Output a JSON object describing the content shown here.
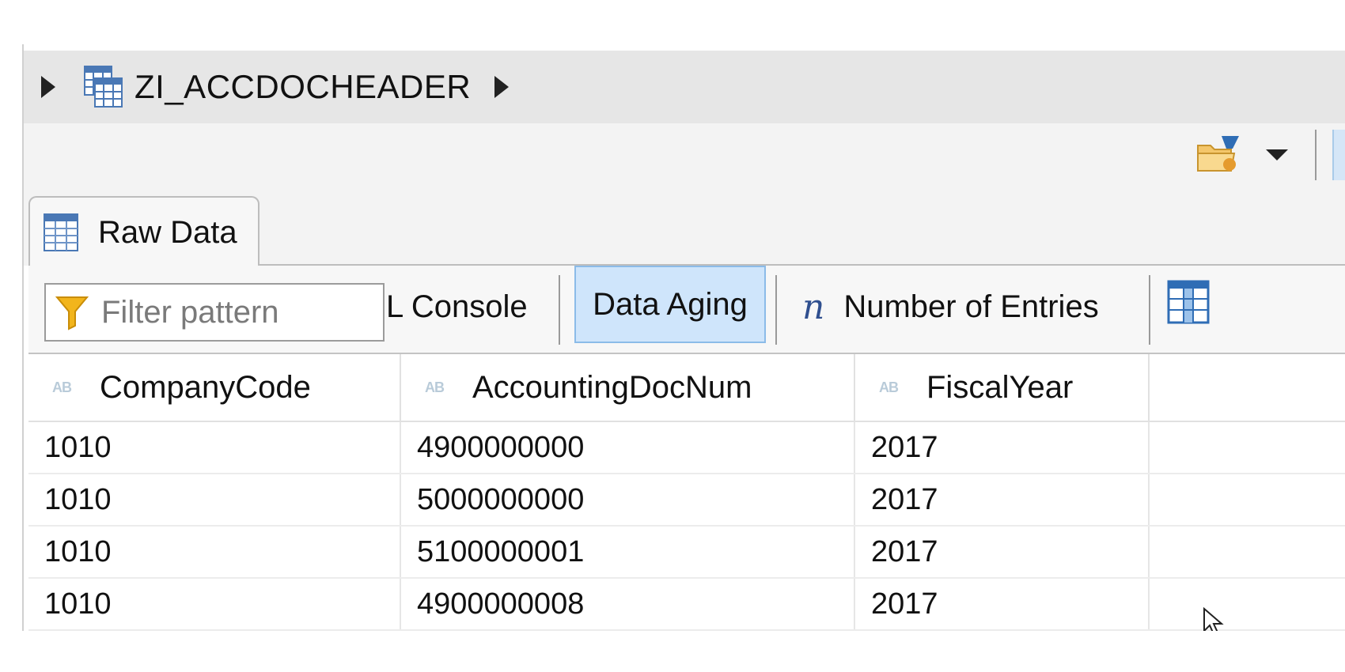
{
  "breadcrumb": {
    "title": "ZI_ACCDOCHEADER"
  },
  "tab": {
    "label": "Raw Data"
  },
  "toolbar": {
    "filter_placeholder": "Filter pattern",
    "console_label": "L Console",
    "data_aging_label": "Data Aging",
    "entries_icon_glyph": "n",
    "entries_label": "Number of Entries"
  },
  "table": {
    "columns": [
      {
        "type_icon": "AB",
        "label": "CompanyCode"
      },
      {
        "type_icon": "AB",
        "label": "AccountingDocNum"
      },
      {
        "type_icon": "AB",
        "label": "FiscalYear"
      }
    ],
    "rows": [
      [
        "1010",
        "4900000000",
        "2017"
      ],
      [
        "1010",
        "5000000000",
        "2017"
      ],
      [
        "1010",
        "5100000001",
        "2017"
      ],
      [
        "1010",
        "4900000008",
        "2017"
      ]
    ]
  },
  "colors": {
    "accent_selected_bg": "#cfe5fb",
    "accent_selected_border": "#8bbbe8",
    "icon_blue": "#2f6db5",
    "funnel_yellow": "#f2b51c"
  },
  "icons": {
    "breadcrumb_expander": "triangle-right-icon",
    "breadcrumb_table": "table-icon",
    "tab_table": "table-icon",
    "filter": "funnel-icon",
    "entries": "n-italic-icon",
    "folder": "folder-icon",
    "columns": "column-settings-icon"
  }
}
